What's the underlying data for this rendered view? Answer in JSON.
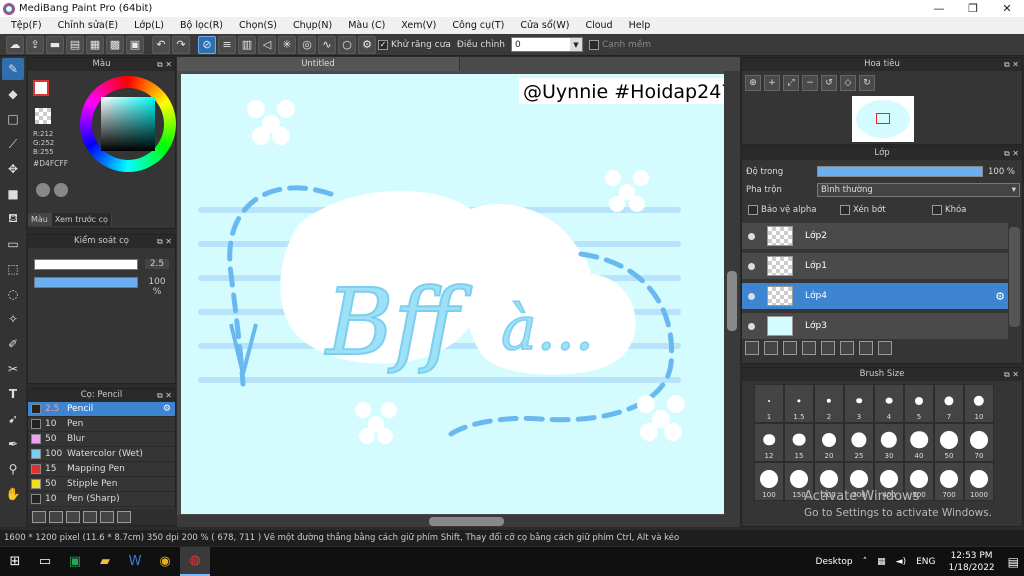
{
  "app": {
    "title": "MediBang Paint Pro (64bit)"
  },
  "window_controls": [
    "—",
    "❐",
    "✕"
  ],
  "menu": [
    "Tệp(F)",
    "Chỉnh sửa(E)",
    "Lớp(L)",
    "Bộ lọc(R)",
    "Chọn(S)",
    "Chụp(N)",
    "Màu (C)",
    "Xem(V)",
    "Công cụ(T)",
    "Cửa sổ(W)",
    "Cloud",
    "Help"
  ],
  "toolbar": {
    "antialias_label": "Khử răng cưa",
    "adjust_label": "Điều chỉnh",
    "adjust_value": "0",
    "edge_label": "Cạnh mềm"
  },
  "color_panel": {
    "title": "Màu",
    "r": "R:212",
    "g": "G:252",
    "b": "B:255",
    "hex": "#D4FCFF",
    "tabs": [
      "Màu",
      "Xem trước cọ"
    ]
  },
  "brush_control": {
    "title": "Kiểm soát cọ",
    "size": "2.5",
    "opacity": "100 %"
  },
  "brush_list": {
    "title": "Cọ: Pencil",
    "items": [
      {
        "size": "2.5",
        "name": "Pencil",
        "color": "#222222",
        "selected": true
      },
      {
        "size": "10",
        "name": "Pen",
        "color": "#222222"
      },
      {
        "size": "50",
        "name": "Blur",
        "color": "#f0a0f0"
      },
      {
        "size": "100",
        "name": "Watercolor (Wet)",
        "color": "#7ad0f0"
      },
      {
        "size": "15",
        "name": "Mapping Pen",
        "color": "#e03030"
      },
      {
        "size": "50",
        "name": "Stipple Pen",
        "color": "#f0e020"
      },
      {
        "size": "10",
        "name": "Pen (Sharp)",
        "color": "#222222"
      }
    ]
  },
  "canvas": {
    "tab": "Untitled",
    "watermark": "@Uynnie #Hoidap247",
    "art_text_1": "Bff",
    "art_text_2": "à...",
    "background": "#d4fcff"
  },
  "navigator": {
    "title": "Hoa tiêu"
  },
  "layer_panel": {
    "title": "Lớp",
    "opacity_label": "Độ trong",
    "opacity_value": "100 %",
    "blend_label": "Pha trộn",
    "blend_value": "Bình thường",
    "protect_alpha": "Bảo vệ alpha",
    "clipping": "Xén bớt",
    "lock": "Khóa",
    "layers": [
      {
        "name": "Lớp2",
        "selected": false
      },
      {
        "name": "Lớp1",
        "selected": false
      },
      {
        "name": "Lớp4",
        "selected": true
      },
      {
        "name": "Lớp3",
        "selected": false
      }
    ]
  },
  "brush_size": {
    "title": "Brush Size",
    "sizes": [
      "1",
      "1.5",
      "2",
      "3",
      "4",
      "5",
      "7",
      "10",
      "12",
      "15",
      "20",
      "25",
      "30",
      "40",
      "50",
      "70",
      "100",
      "150",
      "200",
      "300",
      "400",
      "500",
      "700",
      "1000"
    ]
  },
  "activation": {
    "line1": "Activate Windows",
    "line2": "Go to Settings to activate Windows."
  },
  "status": {
    "text": "1600 * 1200 pixel   (11.6 * 8.7cm)   350 dpi   200 %   ( 678, 711 )   Vẽ một đường thẳng bằng cách giữ phím Shift, Thay đổi cỡ cọ bằng cách giữ phím Ctrl, Alt và kéo"
  },
  "taskbar": {
    "desktop_label": "Desktop",
    "lang": "ENG",
    "time": "12:53 PM",
    "date": "1/18/2022"
  }
}
